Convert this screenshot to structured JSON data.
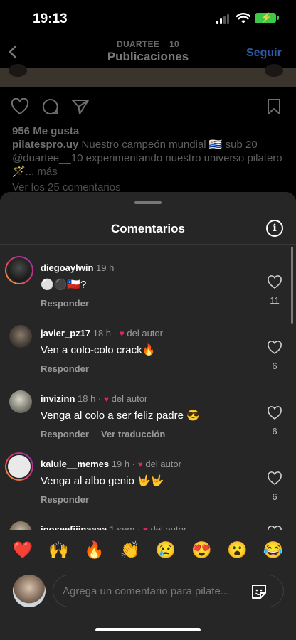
{
  "status": {
    "time": "19:13"
  },
  "nav": {
    "username": "DUARTEE__10",
    "title": "Publicaciones",
    "follow": "Seguir"
  },
  "post": {
    "likes": "956 Me gusta",
    "caption_user": "pilatespro.uy",
    "caption_text": "Nuestro campeón mundial 🇺🇾 sub 20 @duartee__10 experimentando nuestro universo pilatero 🪄...",
    "caption_more": "más",
    "view_comments": "Ver los 25 comentarios"
  },
  "sheet": {
    "title": "Comentarios",
    "comments": [
      {
        "user": "diegoaylwin",
        "time": "19 h",
        "author_like": "",
        "text": "⚪⚫🇨🇱?",
        "reply": "Responder",
        "translate": "",
        "likes": "11"
      },
      {
        "user": "javier_pz17",
        "time": "18 h",
        "author_like": "del autor",
        "text": "Ven a colo-colo crack🔥",
        "reply": "Responder",
        "translate": "",
        "likes": "6"
      },
      {
        "user": "invizinn",
        "time": "18 h",
        "author_like": "del autor",
        "text": "Venga al colo a ser feliz padre 😎",
        "reply": "Responder",
        "translate": "Ver traducción",
        "likes": "6"
      },
      {
        "user": "kalule__memes",
        "time": "19 h",
        "author_like": "del autor",
        "text": "Venga al albo genio 🤟🤟",
        "reply": "Responder",
        "translate": "",
        "likes": "6"
      },
      {
        "user": "jooseefiiinaaaa",
        "time": "1 sem",
        "author_like": "del autor",
        "text": "",
        "reply": "",
        "translate": "",
        "likes": ""
      }
    ],
    "quick_emojis": [
      "❤️",
      "🙌",
      "🔥",
      "👏",
      "😢",
      "😍",
      "😮",
      "😂"
    ],
    "input_placeholder": "Agrega un comentario para pilate..."
  },
  "colors": {
    "sheet_bg": "#262626",
    "like_red": "#e0245e",
    "follow_blue": "#2f5aa6",
    "battery_green": "#3cc94a"
  }
}
